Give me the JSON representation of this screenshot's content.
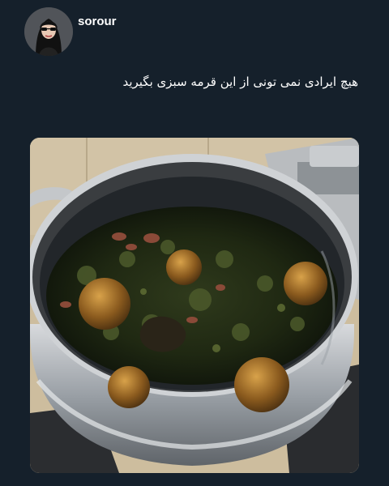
{
  "author": {
    "username": "sorour",
    "avatar_icon": "profile-avatar"
  },
  "tweet": {
    "text": "هیچ ایرادی نمی تونی از این قرمه سبزی بگیرید"
  },
  "media": {
    "type": "photo",
    "subject_icon": "stew-pot-photo"
  },
  "colors": {
    "background": "#15202b",
    "text": "#ffffff"
  }
}
